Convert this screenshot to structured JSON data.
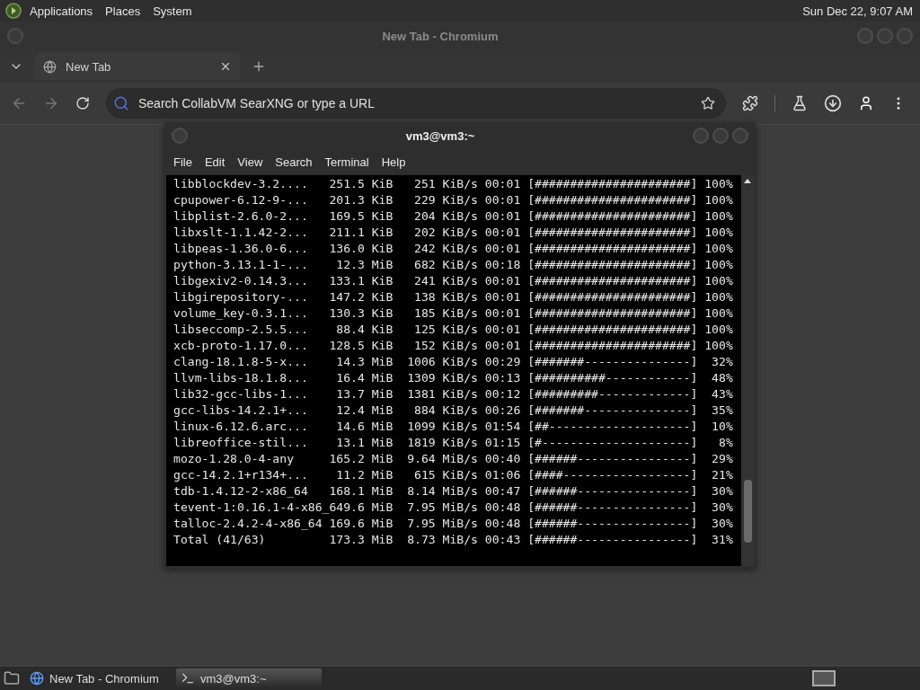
{
  "top_panel": {
    "menus": [
      "Applications",
      "Places",
      "System"
    ],
    "clock": "Sun Dec 22,  9:07 AM"
  },
  "browser": {
    "title": "New Tab - Chromium",
    "tabs": [
      {
        "label": "New Tab",
        "selected": true
      }
    ],
    "address": {
      "placeholder": "Search CollabVM SearXNG or type a URL"
    }
  },
  "terminal": {
    "title": "vm3@vm3:~",
    "menus": [
      "File",
      "Edit",
      "View",
      "Search",
      "Terminal",
      "Help"
    ],
    "rows": [
      {
        "name": "libblockdev-3.2....",
        "size": "251.5 KiB",
        "speed": "251 KiB/s",
        "time": "00:01",
        "bar": "[######################]",
        "percent": "100%"
      },
      {
        "name": "cpupower-6.12-9-...",
        "size": "201.3 KiB",
        "speed": "229 KiB/s",
        "time": "00:01",
        "bar": "[######################]",
        "percent": "100%"
      },
      {
        "name": "libplist-2.6.0-2...",
        "size": "169.5 KiB",
        "speed": "204 KiB/s",
        "time": "00:01",
        "bar": "[######################]",
        "percent": "100%"
      },
      {
        "name": "libxslt-1.1.42-2...",
        "size": "211.1 KiB",
        "speed": "202 KiB/s",
        "time": "00:01",
        "bar": "[######################]",
        "percent": "100%"
      },
      {
        "name": "libpeas-1.36.0-6...",
        "size": "136.0 KiB",
        "speed": "242 KiB/s",
        "time": "00:01",
        "bar": "[######################]",
        "percent": "100%"
      },
      {
        "name": "python-3.13.1-1-...",
        "size": "12.3 MiB",
        "speed": "682 KiB/s",
        "time": "00:18",
        "bar": "[######################]",
        "percent": "100%"
      },
      {
        "name": "libgexiv2-0.14.3...",
        "size": "133.1 KiB",
        "speed": "241 KiB/s",
        "time": "00:01",
        "bar": "[######################]",
        "percent": "100%"
      },
      {
        "name": "libgirepository-...",
        "size": "147.2 KiB",
        "speed": "138 KiB/s",
        "time": "00:01",
        "bar": "[######################]",
        "percent": "100%"
      },
      {
        "name": "volume_key-0.3.1...",
        "size": "130.3 KiB",
        "speed": "185 KiB/s",
        "time": "00:01",
        "bar": "[######################]",
        "percent": "100%"
      },
      {
        "name": "libseccomp-2.5.5...",
        "size": "88.4 KiB",
        "speed": "125 KiB/s",
        "time": "00:01",
        "bar": "[######################]",
        "percent": "100%"
      },
      {
        "name": "xcb-proto-1.17.0...",
        "size": "128.5 KiB",
        "speed": "152 KiB/s",
        "time": "00:01",
        "bar": "[######################]",
        "percent": "100%"
      },
      {
        "name": "clang-18.1.8-5-x...",
        "size": "14.3 MiB",
        "speed": "1006 KiB/s",
        "time": "00:29",
        "bar": "[#######---------------]",
        "percent": "32%"
      },
      {
        "name": "llvm-libs-18.1.8...",
        "size": "16.4 MiB",
        "speed": "1309 KiB/s",
        "time": "00:13",
        "bar": "[##########------------]",
        "percent": "48%"
      },
      {
        "name": "lib32-gcc-libs-1...",
        "size": "13.7 MiB",
        "speed": "1381 KiB/s",
        "time": "00:12",
        "bar": "[#########-------------]",
        "percent": "43%"
      },
      {
        "name": "gcc-libs-14.2.1+...",
        "size": "12.4 MiB",
        "speed": "884 KiB/s",
        "time": "00:26",
        "bar": "[#######---------------]",
        "percent": "35%"
      },
      {
        "name": "linux-6.12.6.arc...",
        "size": "14.6 MiB",
        "speed": "1099 KiB/s",
        "time": "01:54",
        "bar": "[##--------------------]",
        "percent": "10%"
      },
      {
        "name": "libreoffice-stil...",
        "size": "13.1 MiB",
        "speed": "1819 KiB/s",
        "time": "01:15",
        "bar": "[#---------------------]",
        "percent": "8%"
      },
      {
        "name": "mozo-1.28.0-4-any",
        "size": "165.2 MiB",
        "speed": "9.64 MiB/s",
        "time": "00:40",
        "bar": "[######----------------]",
        "percent": "29%"
      },
      {
        "name": "gcc-14.2.1+r134+...",
        "size": "11.2 MiB",
        "speed": "615 KiB/s",
        "time": "01:06",
        "bar": "[####------------------]",
        "percent": "21%"
      },
      {
        "name": "tdb-1.4.12-2-x86_64",
        "size": "168.1 MiB",
        "speed": "8.14 MiB/s",
        "time": "00:47",
        "bar": "[######----------------]",
        "percent": "30%"
      },
      {
        "name": "tevent-1:0.16.1-4-x86_64",
        "size": "9.6 MiB",
        "speed": "7.95 MiB/s",
        "time": "00:48",
        "bar": "[######----------------]",
        "percent": "30%"
      },
      {
        "name": "talloc-2.4.2-4-x86_64",
        "size": "169.6 MiB",
        "speed": "7.95 MiB/s",
        "time": "00:48",
        "bar": "[######----------------]",
        "percent": "30%"
      },
      {
        "name": "Total (41/63)",
        "size": "173.3 MiB",
        "speed": "8.73 MiB/s",
        "time": "00:43",
        "bar": "[######----------------]",
        "percent": "31%"
      }
    ]
  },
  "taskbar": {
    "tasks": [
      {
        "label": "New Tab - Chromium",
        "selected": false
      },
      {
        "label": "vm3@vm3:~",
        "selected": true
      }
    ]
  }
}
